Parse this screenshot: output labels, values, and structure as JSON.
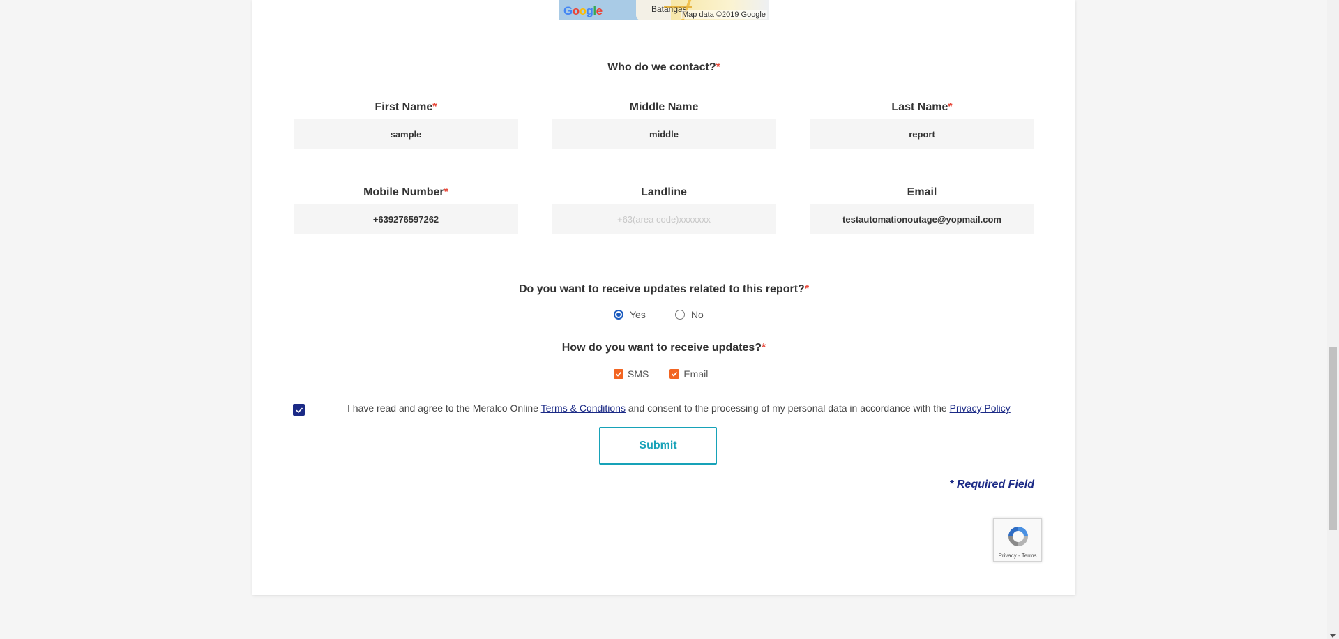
{
  "map": {
    "logo_letters": [
      "G",
      "o",
      "o",
      "g",
      "l",
      "e"
    ],
    "city": "Batangas",
    "attribution": "Map data ©2019 Google"
  },
  "contact": {
    "heading": "Who do we contact?",
    "required_mark": "*"
  },
  "fields": {
    "first_name": {
      "label": "First Name",
      "required": "*",
      "value": "sample"
    },
    "middle_name": {
      "label": "Middle Name",
      "required": "",
      "value": "middle"
    },
    "last_name": {
      "label": "Last Name",
      "required": "*",
      "value": "report"
    },
    "mobile": {
      "label": "Mobile Number",
      "required": "*",
      "value": "+639276597262"
    },
    "landline": {
      "label": "Landline",
      "required": "",
      "value": "",
      "placeholder": "+63(area code)xxxxxxx"
    },
    "email": {
      "label": "Email",
      "required": "*",
      "value": "testautomationoutage@yopmail.com"
    }
  },
  "updates": {
    "question": "Do you want to receive updates related to this report?",
    "required_mark": "*",
    "options": [
      {
        "label": "Yes",
        "selected": true
      },
      {
        "label": "No",
        "selected": false
      }
    ]
  },
  "channels": {
    "question": "How do you want to receive updates?",
    "required_mark": "*",
    "options": [
      {
        "label": "SMS",
        "checked": true
      },
      {
        "label": "Email",
        "checked": true
      }
    ]
  },
  "consent": {
    "checked": true,
    "text_before": "I have read and agree to the Meralco Online ",
    "terms_link": "Terms & Conditions",
    "text_middle": " and consent to the processing of my personal data in accordance with the ",
    "privacy_link": "Privacy Policy"
  },
  "submit_label": "Submit",
  "required_note": "* Required Field",
  "recaptcha": {
    "links": "Privacy - Terms"
  },
  "colors": {
    "accent_teal": "#17a2b8",
    "brand_navy": "#1b2a86",
    "required_red": "#e84a3c",
    "checkbox_orange": "#f26522"
  }
}
